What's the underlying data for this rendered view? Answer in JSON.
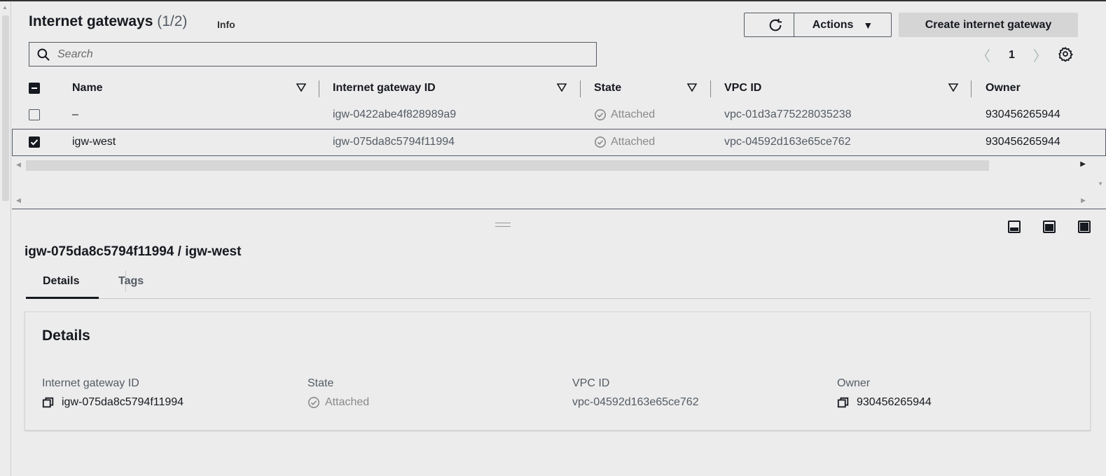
{
  "header": {
    "title": "Internet gateways",
    "count": "(1/2)",
    "info": "Info",
    "actions_label": "Actions",
    "create_label": "Create internet gateway",
    "search_placeholder": "Search",
    "page": "1"
  },
  "table": {
    "columns": [
      "Name",
      "Internet gateway ID",
      "State",
      "VPC ID",
      "Owner"
    ],
    "rows": [
      {
        "name": "–",
        "id": "igw-0422abe4f828989a9",
        "state": "Attached",
        "vpc": "vpc-01d3a775228035238",
        "owner": "930456265944",
        "selected": false
      },
      {
        "name": "igw-west",
        "id": "igw-075da8c5794f11994",
        "state": "Attached",
        "vpc": "vpc-04592d163e65ce762",
        "owner": "930456265944",
        "selected": true
      }
    ]
  },
  "detail": {
    "title": "igw-075da8c5794f11994 / igw-west",
    "tabs": [
      "Details",
      "Tags"
    ],
    "card_title": "Details",
    "fields": [
      {
        "label": "Internet gateway ID",
        "value": "igw-075da8c5794f11994"
      },
      {
        "label": "State",
        "value": "Attached"
      },
      {
        "label": "VPC ID",
        "value": "vpc-04592d163e65ce762"
      },
      {
        "label": "Owner",
        "value": "930456265944"
      }
    ]
  },
  "colors": {
    "text": "#16191f",
    "muted": "#545b64",
    "background": "#ececec"
  },
  "icons": [
    "search-icon",
    "refresh-icon",
    "caret-down-icon",
    "settings-icon",
    "sort-icon",
    "check-circle-icon",
    "copy-icon"
  ]
}
